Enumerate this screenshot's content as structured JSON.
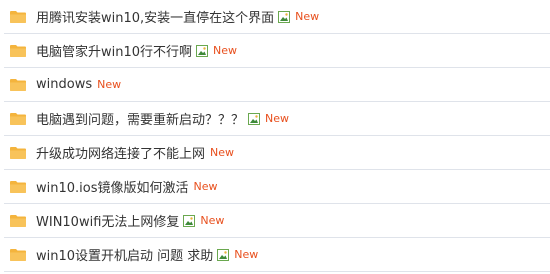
{
  "colors": {
    "title_text": "#333333",
    "new_badge": "#e8501e",
    "divider": "#dfe3ea",
    "folder": "#f4b43d",
    "image_icon_frame": "#6aa84f"
  },
  "threads": [
    {
      "title": "用腾讯安装win10,安装一直停在这个界面",
      "has_image": true,
      "badge": "New",
      "icon": "folder-icon"
    },
    {
      "title": "电脑管家升win10行不行啊",
      "has_image": true,
      "badge": "New",
      "icon": "folder-icon"
    },
    {
      "title": "windows",
      "has_image": false,
      "badge": "New",
      "icon": "folder-icon"
    },
    {
      "title": "电脑遇到问题，需要重新启动？？？",
      "has_image": true,
      "badge": "New",
      "icon": "folder-icon"
    },
    {
      "title": "升级成功网络连接了不能上网",
      "has_image": false,
      "badge": "New",
      "icon": "folder-icon"
    },
    {
      "title": "win10.ios镜像版如何激活",
      "has_image": false,
      "badge": "New",
      "icon": "folder-icon"
    },
    {
      "title": "WIN10wifi无法上网修复",
      "has_image": true,
      "badge": "New",
      "icon": "folder-icon"
    },
    {
      "title": "win10设置开机启动 问题 求助",
      "has_image": true,
      "badge": "New",
      "icon": "folder-icon"
    }
  ]
}
